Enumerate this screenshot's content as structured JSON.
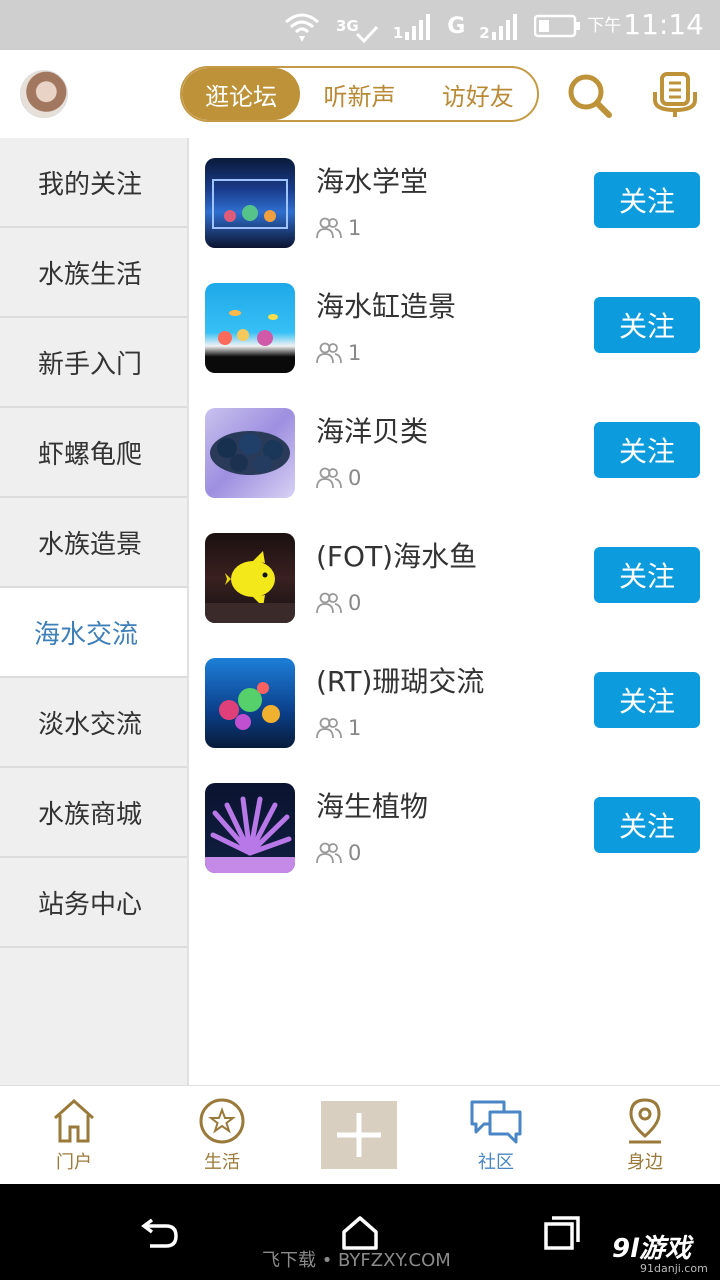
{
  "status_bar": {
    "network_3g": "3G",
    "signal_1": "1",
    "network_g": "G",
    "signal_2": "2",
    "time_prefix": "下午",
    "time": "11:14"
  },
  "header": {
    "tabs": [
      {
        "label": "逛论坛",
        "active": true
      },
      {
        "label": "听新声",
        "active": false
      },
      {
        "label": "访好友",
        "active": false
      }
    ],
    "accent_color": "#bd9238"
  },
  "sidebar": {
    "items": [
      {
        "label": "我的关注",
        "active": false
      },
      {
        "label": "水族生活",
        "active": false
      },
      {
        "label": "新手入门",
        "active": false
      },
      {
        "label": "虾螺龟爬",
        "active": false
      },
      {
        "label": "水族造景",
        "active": false
      },
      {
        "label": "海水交流",
        "active": true
      },
      {
        "label": "淡水交流",
        "active": false
      },
      {
        "label": "水族商城",
        "active": false
      },
      {
        "label": "站务中心",
        "active": false
      }
    ],
    "active_color": "#3f7fb8"
  },
  "forums": [
    {
      "name": "海水学堂",
      "followers": "1",
      "follow_label": "关注"
    },
    {
      "name": "海水缸造景",
      "followers": "1",
      "follow_label": "关注"
    },
    {
      "name": "海洋贝类",
      "followers": "0",
      "follow_label": "关注"
    },
    {
      "name": "(FOT)海水鱼",
      "followers": "0",
      "follow_label": "关注"
    },
    {
      "name": "(RT)珊瑚交流",
      "followers": "1",
      "follow_label": "关注"
    },
    {
      "name": "海生植物",
      "followers": "0",
      "follow_label": "关注"
    }
  ],
  "follow_button_color": "#0c9bdc",
  "bottom_nav": {
    "items": [
      {
        "label": "门户",
        "icon": "home-icon"
      },
      {
        "label": "生活",
        "icon": "star-icon"
      },
      {
        "label": "社区",
        "icon": "chat-icon",
        "active": true
      },
      {
        "label": "身边",
        "icon": "location-pin-icon"
      }
    ],
    "add_icon": "plus-icon"
  },
  "watermark": "飞下载 • BYFZXY.COM",
  "corner_logo": "9l游戏",
  "corner_logo_sub": "91danji.com"
}
